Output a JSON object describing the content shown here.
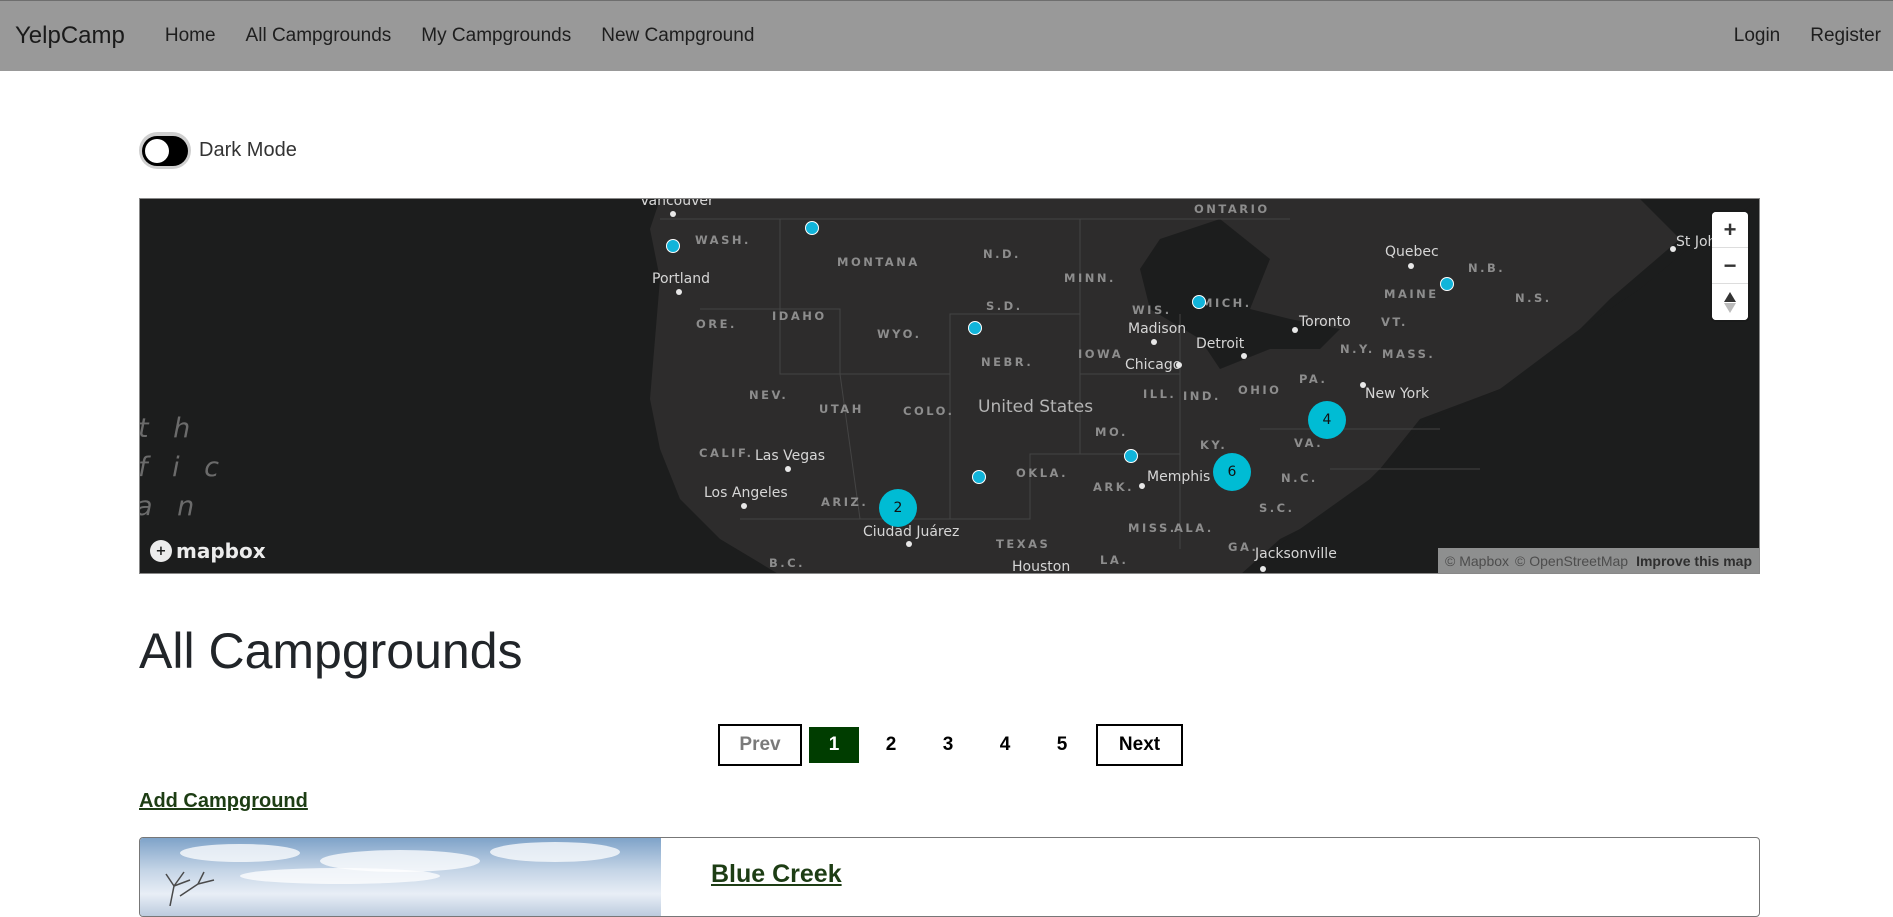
{
  "navbar": {
    "brand": "YelpCamp",
    "links": [
      "Home",
      "All Campgrounds",
      "My Campgrounds",
      "New Campground"
    ],
    "right_links": [
      "Login",
      "Register"
    ]
  },
  "dark_mode": {
    "label": "Dark Mode",
    "enabled": false
  },
  "map": {
    "country_label": "United States",
    "ocean_label_fragments": [
      "t h",
      "f i c",
      "a n"
    ],
    "state_labels": [
      "WASH.",
      "MONTANA",
      "N.D.",
      "MINN.",
      "ONTARIO",
      "ORE.",
      "IDAHO",
      "WYO.",
      "S.D.",
      "WIS.",
      "MICH.",
      "NEBR.",
      "IOWA",
      "NEV.",
      "UTAH",
      "COLO.",
      "ILL.",
      "IND.",
      "OHIO",
      "PA.",
      "N.Y.",
      "VT.",
      "MASS.",
      "MAINE",
      "N.B.",
      "N.S.",
      "CALIF.",
      "ARIZ.",
      "OKLA.",
      "MO.",
      "KY.",
      "VA.",
      "ARK.",
      "N.C.",
      "S.C.",
      "MISS.",
      "ALA.",
      "GA.",
      "LA.",
      "TEXAS",
      "B.C."
    ],
    "city_labels": [
      "Vancouver",
      "Portland",
      "Quebec",
      "St Johns",
      "Madison",
      "Toronto",
      "Detroit",
      "Chicago",
      "New York",
      "Las Vegas",
      "Los Angeles",
      "Memphis",
      "Ciudad Juárez",
      "Jacksonville",
      "Houston"
    ],
    "clusters": [
      {
        "count": "2",
        "near": "Arizona / New Mexico"
      },
      {
        "count": "6",
        "near": "Tennessee / North Carolina"
      },
      {
        "count": "4",
        "near": "Virginia"
      }
    ],
    "single_pins": 7,
    "controls": {
      "zoom_in": "+",
      "zoom_out": "−",
      "compass": "compass-icon"
    },
    "logo": "mapbox",
    "attribution": [
      "© Mapbox",
      "© OpenStreetMap"
    ],
    "improve_link": "Improve this map",
    "pin_color": "#11b4da",
    "cluster_color": "#00bcd4"
  },
  "page_title": "All Campgrounds",
  "pagination": {
    "prev": "Prev",
    "pages": [
      "1",
      "2",
      "3",
      "4",
      "5"
    ],
    "current": "1",
    "next": "Next",
    "active_color": "#003d00"
  },
  "add_campground_label": "Add Campground",
  "campgrounds": [
    {
      "title": "Blue Creek"
    }
  ]
}
